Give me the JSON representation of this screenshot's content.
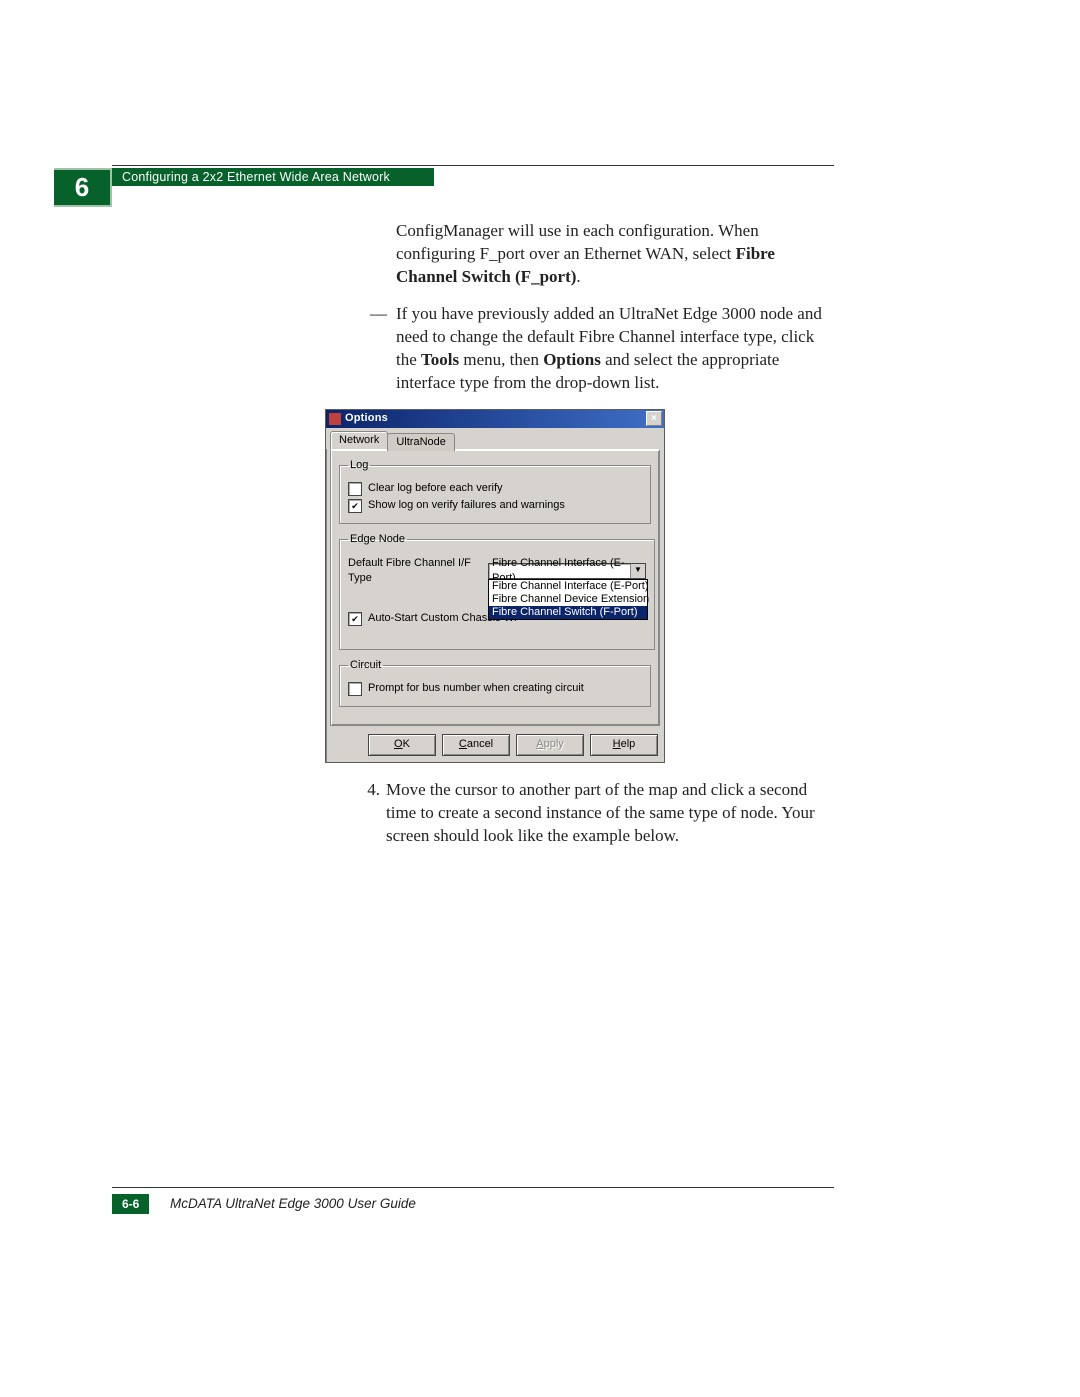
{
  "chapter_number": "6",
  "chapter_title": "Configuring a 2x2 Ethernet Wide Area Network",
  "body": {
    "bullet1": {
      "pre": "ConfigManager will use in each configuration. When configuring F_port over an Ethernet WAN, select ",
      "bold": "Fibre Channel Switch (F_port)",
      "post": "."
    },
    "bullet2": {
      "pre": "If you have previously added an UltraNet Edge 3000 node and need to change the default Fibre Channel interface type, click the ",
      "b1": "Tools",
      "mid1": " menu, then ",
      "b2": "Options",
      "post": " and select the appropriate interface type from the drop-down list."
    },
    "step4": {
      "num": "4.",
      "text": "Move the cursor to another part of the map and click a second time to create a second instance of the same type of node. Your screen should look like the example below."
    }
  },
  "dialog": {
    "title": "Options",
    "tabs": {
      "network": "Network",
      "ultranode": "UltraNode"
    },
    "log": {
      "legend": "Log",
      "clear": "Clear log before each verify",
      "show": "Show log on verify failures and warnings"
    },
    "edge": {
      "legend": "Edge Node",
      "label_if": "Default Fibre Channel I/F Type",
      "selected": "Fibre Channel Interface (E-Port)",
      "opt0": "Fibre Channel Interface (E-Port)",
      "opt1": "Fibre Channel Device Extension",
      "opt2": "Fibre Channel Switch (F-Port)",
      "auto": "Auto-Start Custom Chassis Wi"
    },
    "circuit": {
      "legend": "Circuit",
      "prompt": "Prompt for bus number when creating circuit"
    },
    "buttons": {
      "ok_u": "O",
      "ok_r": "K",
      "cancel_u": "C",
      "cancel_r": "ancel",
      "apply_u": "A",
      "apply_r": "pply",
      "help_u": "H",
      "help_r": "elp"
    },
    "close_glyph": "×"
  },
  "footer": {
    "page": "6-6",
    "title": "McDATA UltraNet Edge 3000 User Guide"
  }
}
